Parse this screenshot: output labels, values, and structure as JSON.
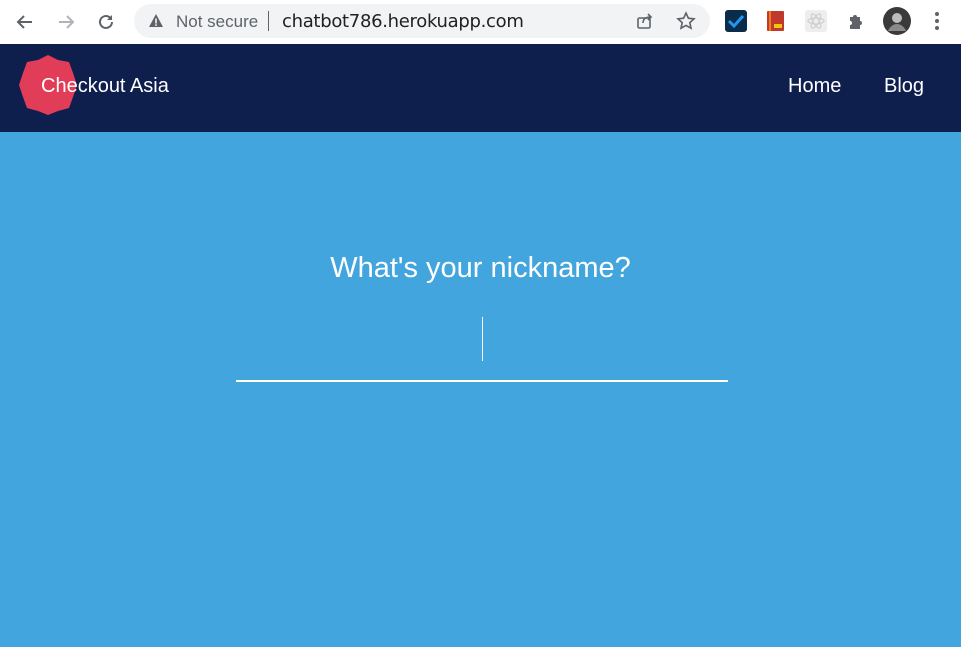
{
  "browser": {
    "security_label": "Not secure",
    "url": "chatbot786.herokuapp.com"
  },
  "site": {
    "brand": "Checkout Asia",
    "nav": [
      "Home",
      "Blog"
    ],
    "brand_color": "#e23d58",
    "navbar_color": "#0e1f4d",
    "background_color": "#42a5de"
  },
  "main": {
    "question": "What's your nickname?",
    "nickname_value": ""
  }
}
